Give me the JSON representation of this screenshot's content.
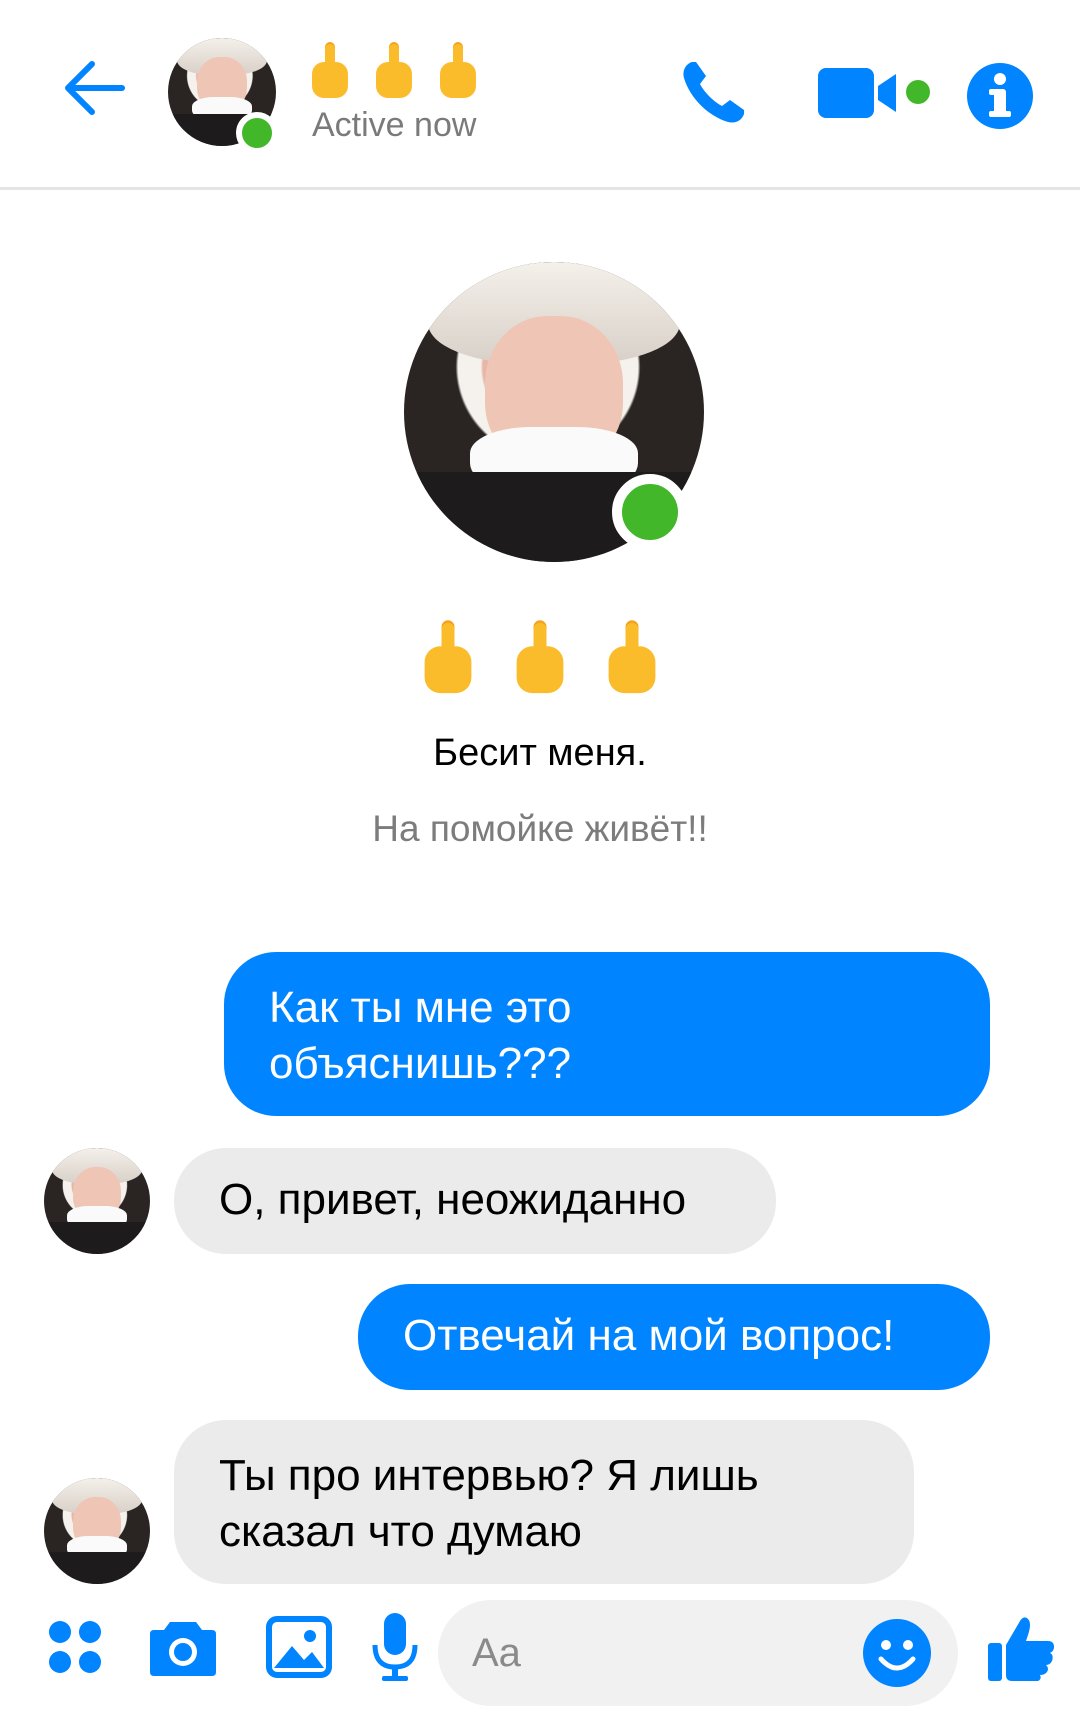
{
  "colors": {
    "accent": "#0084ff",
    "online": "#42b72a",
    "incoming_bubble": "#ebebeb",
    "emoji_yellow": "#fbbc2c"
  },
  "header": {
    "title_emoji": [
      "🖕",
      "🖕",
      "🖕"
    ],
    "status": "Active now",
    "icons": [
      "back-arrow-icon",
      "phone-icon",
      "video-camera-icon",
      "info-icon"
    ]
  },
  "profile": {
    "name_emoji": [
      "🖕",
      "🖕",
      "🖕"
    ],
    "subtitle": "Бесит меня.",
    "bio": "На помойке живёт!!"
  },
  "messages": [
    {
      "direction": "out",
      "text_lines": [
        "Как ты мне это",
        "объяснишь???"
      ]
    },
    {
      "direction": "in",
      "text_lines": [
        "О, привет, неожиданно"
      ]
    },
    {
      "direction": "out",
      "text_lines": [
        "Отвечай на мой вопрос!"
      ]
    },
    {
      "direction": "in",
      "text_lines": [
        "Ты про интервью? Я лишь",
        "сказал что думаю"
      ]
    }
  ],
  "composer": {
    "placeholder": "Aa",
    "icons": [
      "menu-dots-icon",
      "camera-icon",
      "gallery-icon",
      "microphone-icon",
      "emoji-icon",
      "thumbs-up-icon"
    ]
  }
}
